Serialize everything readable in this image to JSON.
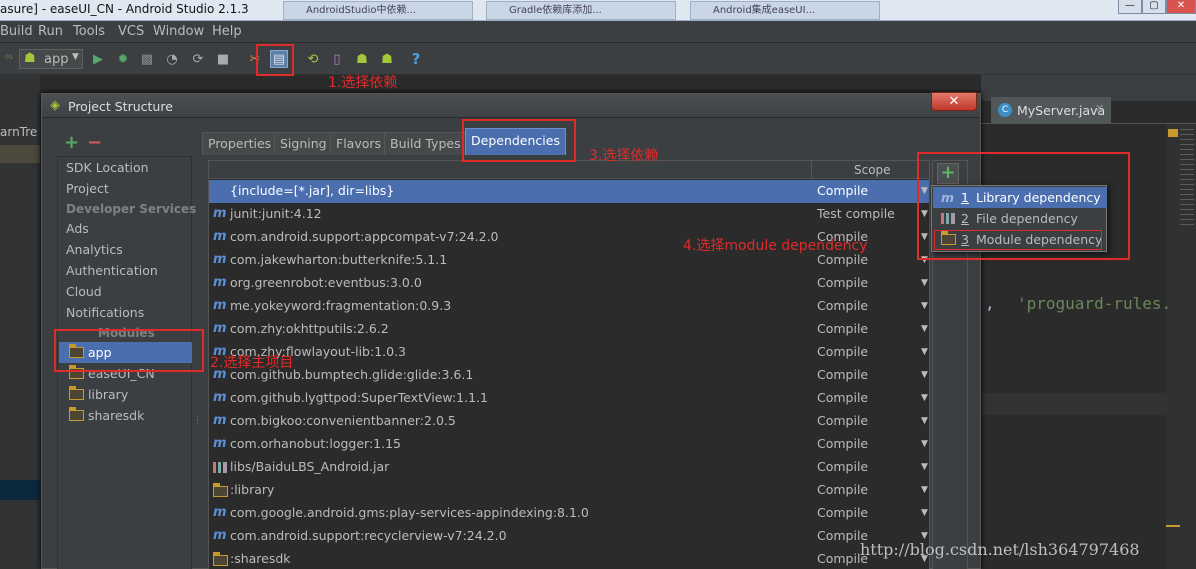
{
  "window": {
    "title": "asure] - easeUI_CN - Android Studio 2.1.3",
    "browser_tabs": [
      "AndroidStudio中依赖...",
      "Gradle依赖库添加...",
      "Android集成easeUI..."
    ],
    "controls": [
      "—",
      "▢",
      "✕"
    ]
  },
  "menu": [
    "Build",
    "Run",
    "Tools",
    "VCS",
    "Window",
    "Help"
  ],
  "toolbar": {
    "run_config": "app",
    "help": "?"
  },
  "editor": {
    "tab_myserver": "MyServer.java",
    "left_snippet": "arnTre",
    "code_snippet_sep": ",",
    "code_snippet": "'proguard-rules."
  },
  "dialog": {
    "title": "Project Structure",
    "close": "✕",
    "left_header_add": "+",
    "left_header_remove": "−",
    "left_items": [
      "SDK Location",
      "Project"
    ],
    "developer_services_header": "Developer Services",
    "developer_services": [
      "Ads",
      "Analytics",
      "Authentication",
      "Cloud",
      "Notifications"
    ],
    "modules_header": "Modules",
    "modules": [
      "app",
      "easeUI_CN",
      "library",
      "sharesdk"
    ],
    "tabs": [
      "Properties",
      "Signing",
      "Flavors",
      "Build Types",
      "Dependencies"
    ],
    "table": {
      "scope_header": "Scope",
      "rows": [
        {
          "name": "{include=[*.jar], dir=libs}",
          "scope": "Compile",
          "type": "file"
        },
        {
          "name": "junit:junit:4.12",
          "scope": "Test compile",
          "type": "maven"
        },
        {
          "name": "com.android.support:appcompat-v7:24.2.0",
          "scope": "Compile",
          "type": "maven"
        },
        {
          "name": "com.jakewharton:butterknife:5.1.1",
          "scope": "Compile",
          "type": "maven"
        },
        {
          "name": "org.greenrobot:eventbus:3.0.0",
          "scope": "Compile",
          "type": "maven"
        },
        {
          "name": "me.yokeyword:fragmentation:0.9.3",
          "scope": "Compile",
          "type": "maven"
        },
        {
          "name": "com.zhy:okhttputils:2.6.2",
          "scope": "Compile",
          "type": "maven"
        },
        {
          "name": "com.zhy:flowlayout-lib:1.0.3",
          "scope": "Compile",
          "type": "maven"
        },
        {
          "name": "com.github.bumptech.glide:glide:3.6.1",
          "scope": "Compile",
          "type": "maven"
        },
        {
          "name": "com.github.lygttpod:SuperTextView:1.1.1",
          "scope": "Compile",
          "type": "maven"
        },
        {
          "name": "com.bigkoo:convenientbanner:2.0.5",
          "scope": "Compile",
          "type": "maven"
        },
        {
          "name": "com.orhanobut:logger:1.15",
          "scope": "Compile",
          "type": "maven"
        },
        {
          "name": "libs/BaiduLBS_Android.jar",
          "scope": "Compile",
          "type": "jar"
        },
        {
          "name": ":library",
          "scope": "Compile",
          "type": "module"
        },
        {
          "name": "com.google.android.gms:play-services-appindexing:8.1.0",
          "scope": "Compile",
          "type": "maven"
        },
        {
          "name": "com.android.support:recyclerview-v7:24.2.0",
          "scope": "Compile",
          "type": "maven"
        },
        {
          "name": ":sharesdk",
          "scope": "Compile",
          "type": "module"
        }
      ]
    },
    "add_button": "+",
    "popup": [
      {
        "num": "1",
        "label": "Library dependency"
      },
      {
        "num": "2",
        "label": "File dependency"
      },
      {
        "num": "3",
        "label": "Module dependency"
      }
    ]
  },
  "annotations": {
    "step1": "1.选择依赖",
    "step2": "2.选择主项目",
    "step3": "3.选择依赖",
    "step4": "4.选择module dependency",
    "accent": "#e02b2b"
  },
  "watermark": "http://blog.csdn.net/lsh364797468"
}
